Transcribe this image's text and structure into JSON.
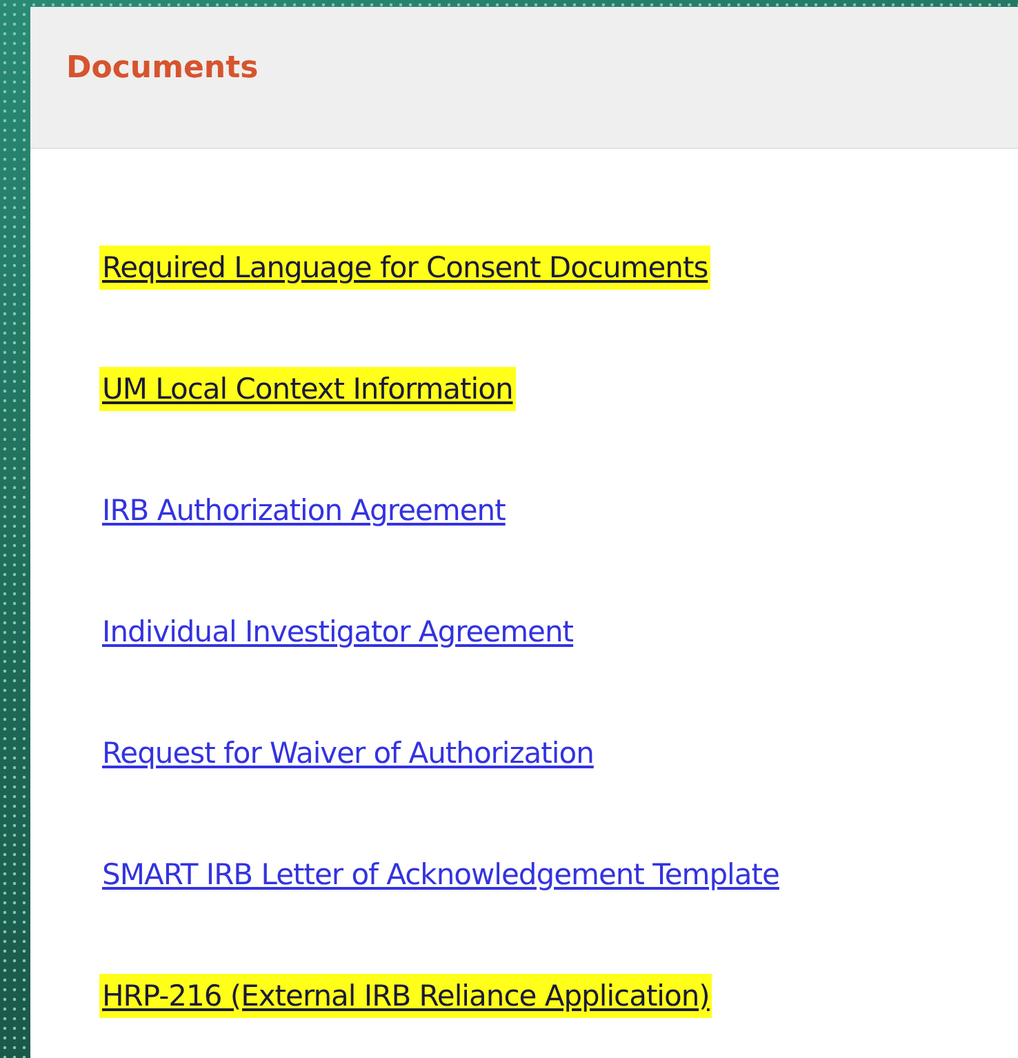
{
  "panel": {
    "title": "Documents"
  },
  "links": [
    {
      "label": "Required Language for Consent Documents",
      "highlighted": true
    },
    {
      "label": "UM Local Context Information",
      "highlighted": true
    },
    {
      "label": "IRB Authorization Agreement",
      "highlighted": false
    },
    {
      "label": "Individual Investigator Agreement",
      "highlighted": false
    },
    {
      "label": "Request for Waiver of Authorization",
      "highlighted": false
    },
    {
      "label": "SMART IRB Letter of Acknowledgement Template",
      "highlighted": false
    },
    {
      "label": "HRP-216 (External IRB Reliance Application)",
      "highlighted": true
    }
  ]
}
